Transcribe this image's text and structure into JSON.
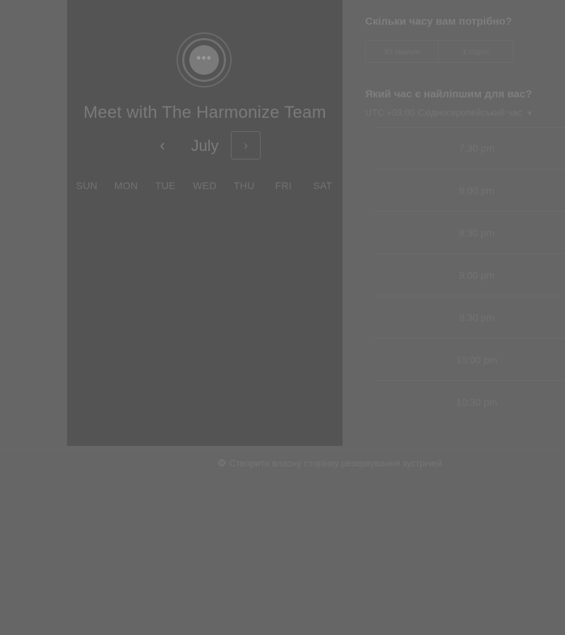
{
  "header": {
    "title": "Meet with The Harmonize Team"
  },
  "calendar": {
    "month": "July",
    "prev_icon": "‹",
    "next_icon": "›",
    "weekdays": [
      "SUN",
      "MON",
      "TUE",
      "WED",
      "THU",
      "FRI",
      "SAT"
    ]
  },
  "duration": {
    "question": "Скільки часу вам потрібно?",
    "options": [
      "30 хвилин",
      "1 годин"
    ]
  },
  "time": {
    "question": "Який час є найліпшим для вас?",
    "timezone": "UTC +03:00 Східноєвропейський час",
    "slots": [
      "7:30 pm",
      "8:00 pm",
      "8:30 pm",
      "9:00 pm",
      "9:30 pm",
      "10:00 pm",
      "10:30 pm"
    ]
  },
  "footer": {
    "link_text": "Створити власну сторінку резервування зустрічей"
  },
  "icons": {
    "avatar": "chat-bubble-icon",
    "footer": "hubspot-icon"
  }
}
